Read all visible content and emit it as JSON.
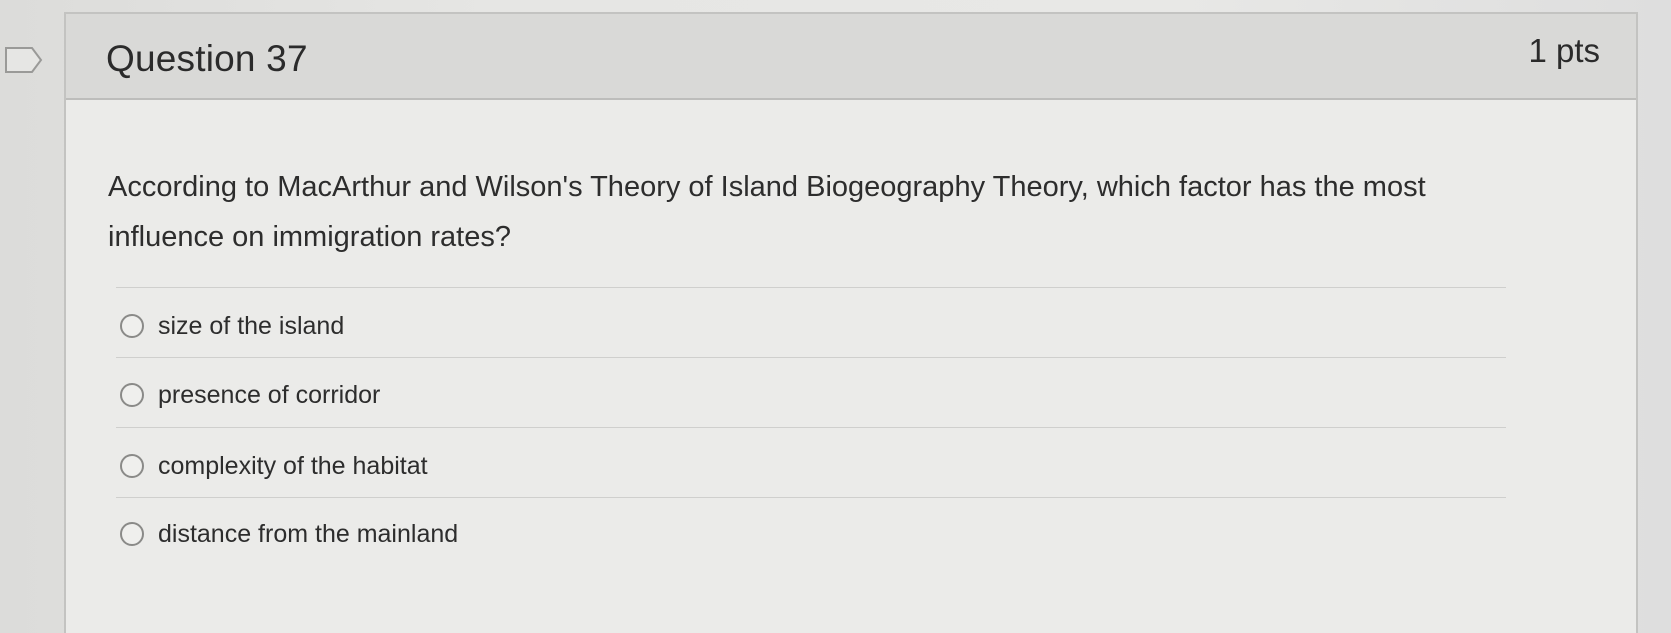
{
  "question": {
    "title": "Question 37",
    "points": "1 pts",
    "text": "According to MacArthur and Wilson's Theory of Island Biogeography Theory, which factor has the most influence on immigration rates?",
    "options": [
      "size of the island",
      "presence of corridor",
      "complexity of the habitat",
      "distance from the mainland"
    ]
  },
  "icons": {
    "flag": "flag-question-icon",
    "radio": "radio-unselected-icon"
  }
}
